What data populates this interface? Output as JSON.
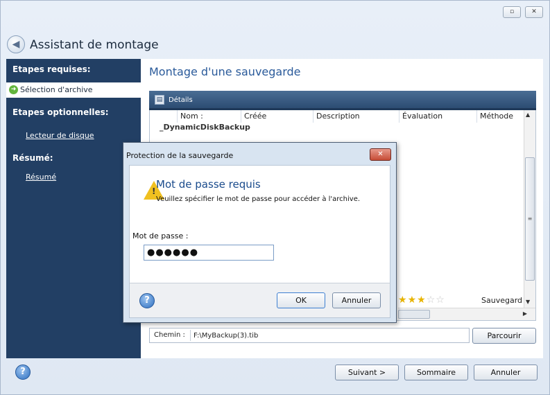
{
  "window": {
    "title": "Assistant de montage",
    "restore_label": "▫",
    "close_label": "✕"
  },
  "sidebar": {
    "required_heading": "Etapes requises:",
    "selected_step": "Sélection d'archive",
    "optional_heading": "Etapes optionnelles:",
    "optional_link": "Lecteur de disque",
    "summary_heading": "Résumé:",
    "summary_link": "Résumé"
  },
  "main": {
    "title": "Montage d'une sauvegarde",
    "details_label": "Détails",
    "columns": [
      "Nom :",
      "Créée",
      "Description",
      "Évaluation",
      "Méthode"
    ],
    "first_row": "_DynamicDiskBackup",
    "rating": 3,
    "rating_max": 5,
    "method_value": "Sauvegard",
    "path_label": "Chemin :",
    "path_value": "F:\\MyBackup(3).tib",
    "browse_label": "Parcourir"
  },
  "footer": {
    "next_label": "Suivant >",
    "summary_label": "Sommaire",
    "cancel_label": "Annuler"
  },
  "dialog": {
    "title": "Protection de la sauvegarde",
    "heading": "Mot de passe requis",
    "message": "Veuillez spécifier le mot de passe pour accéder à l'archive.",
    "password_label": "Mot de passe :",
    "password_value": "●●●●●●",
    "ok_label": "OK",
    "cancel_label": "Annuler"
  },
  "icons": {
    "back": "back-arrow-icon",
    "help": "help-icon",
    "warning": "warning-icon",
    "details": "details-icon",
    "step_arrow": "arrow-right-icon"
  },
  "colors": {
    "sidebar": "#223f64",
    "accent_title": "#2a5a9a",
    "star": "#e8b400"
  }
}
